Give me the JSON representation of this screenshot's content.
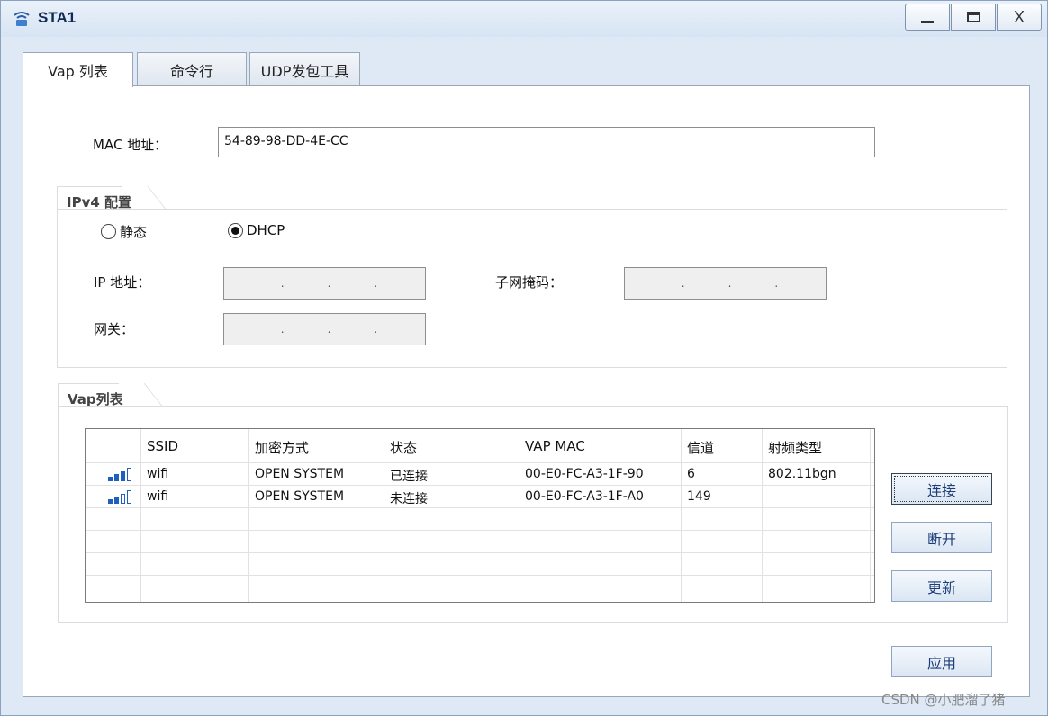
{
  "window": {
    "title": "STA1",
    "minimize": "_",
    "close": "X"
  },
  "tabs": [
    {
      "label": "Vap 列表"
    },
    {
      "label": "命令行"
    },
    {
      "label": "UDP发包工具"
    }
  ],
  "mac": {
    "label": "MAC 地址：",
    "value": "54-89-98-DD-4E-CC"
  },
  "ipv4": {
    "group_title": "IPv4 配置",
    "static_label": "静态",
    "dhcp_label": "DHCP",
    "selected": "DHCP",
    "ip_label": "IP 地址：",
    "mask_label": "子网掩码：",
    "gateway_label": "网关：",
    "dot": "."
  },
  "vap": {
    "group_title": "Vap列表",
    "columns": [
      "",
      "SSID",
      "加密方式",
      "状态",
      "VAP MAC",
      "信道",
      "射频类型"
    ],
    "rows": [
      {
        "signal": 3,
        "ssid": "wifi",
        "encryption": "OPEN SYSTEM",
        "status": "已连接",
        "vap_mac": "00-E0-FC-A3-1F-90",
        "channel": "6",
        "radio": "802.11bgn"
      },
      {
        "signal": 2,
        "ssid": "wifi",
        "encryption": "OPEN SYSTEM",
        "status": "未连接",
        "vap_mac": "00-E0-FC-A3-1F-A0",
        "channel": "149",
        "radio": ""
      }
    ]
  },
  "buttons": {
    "connect": "连接",
    "disconnect": "断开",
    "refresh": "更新",
    "apply": "应用"
  },
  "watermark": "CSDN @小肥溜了猪"
}
